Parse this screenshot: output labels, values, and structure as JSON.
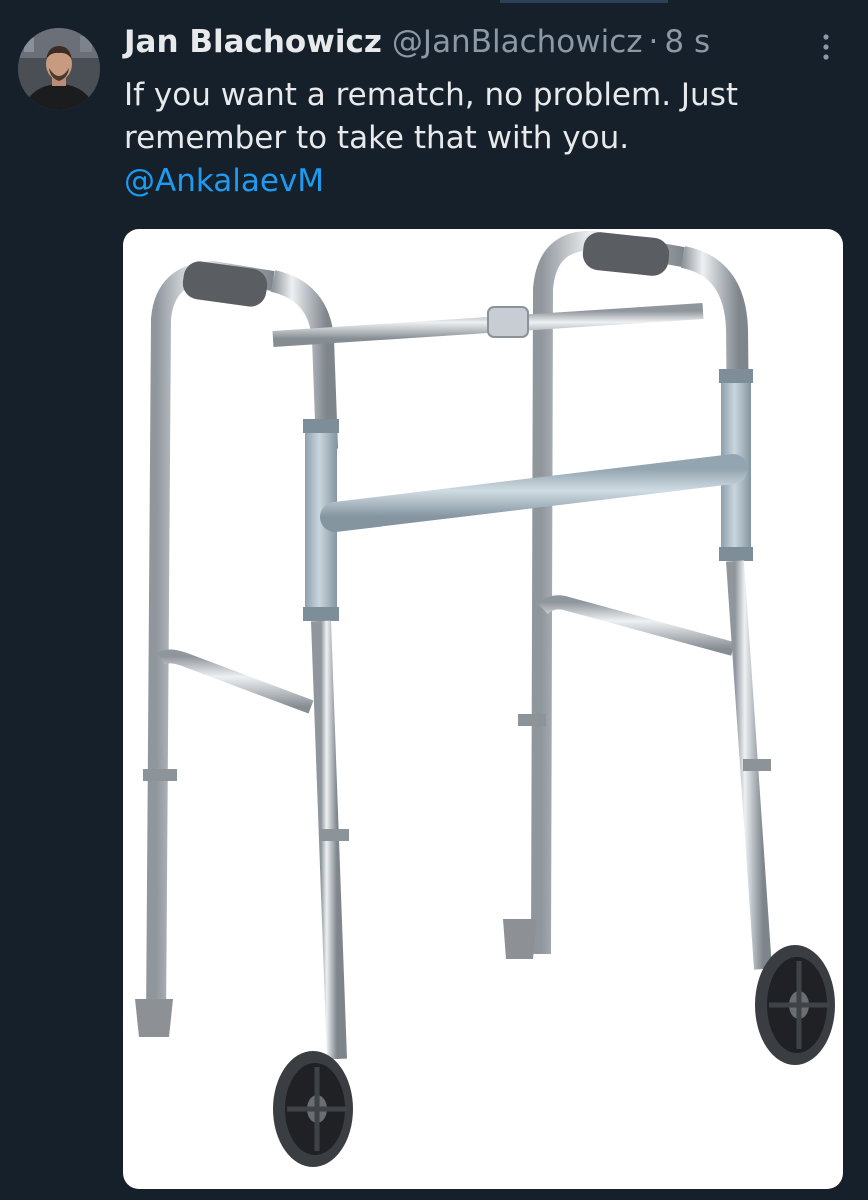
{
  "tweet": {
    "display_name": "Jan Blachowicz",
    "handle": "@JanBlachowicz",
    "separator": "·",
    "time": "8 s",
    "text_line_1": "If you want a rematch, no problem. Just",
    "text_line_2": "remember to take that with you.",
    "mention": "@AnkalaevM"
  },
  "icons": {
    "more": "more-vertical-icon",
    "avatar": "user-avatar"
  },
  "colors": {
    "background": "#15202b",
    "text": "#e7e9ea",
    "secondary_text": "#8b98a5",
    "link": "#1d9bf0"
  }
}
